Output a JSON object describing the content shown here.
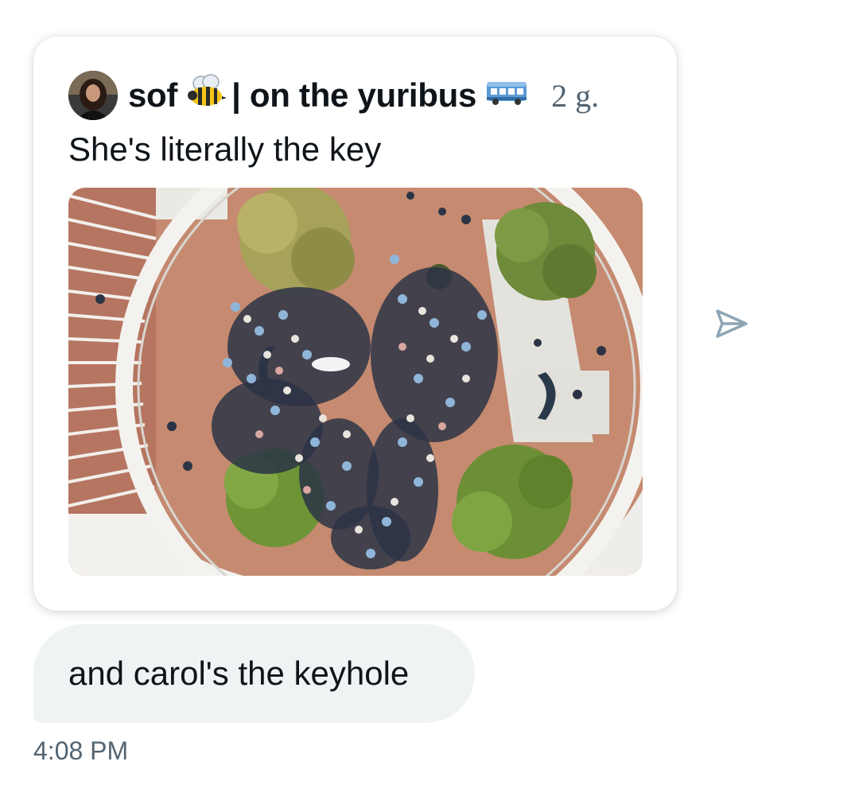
{
  "quoted_post": {
    "author_name": "sof",
    "name_suffix": "| on the yuribus",
    "emoji_1": "bee-emoji",
    "emoji_2": "bus-emoji",
    "time_ago": "2 g.",
    "text": "She's literally the key",
    "image": "aerial-crowd-photo"
  },
  "send_icon": "send-arrow-icon",
  "message": {
    "text": "and carol's the keyhole",
    "time": "4:08 PM"
  },
  "colors": {
    "bubble_bg": "#eff3f4",
    "secondary_text": "#536471",
    "primary_text": "#0f1419",
    "send_icon": "#8ea4b4"
  }
}
